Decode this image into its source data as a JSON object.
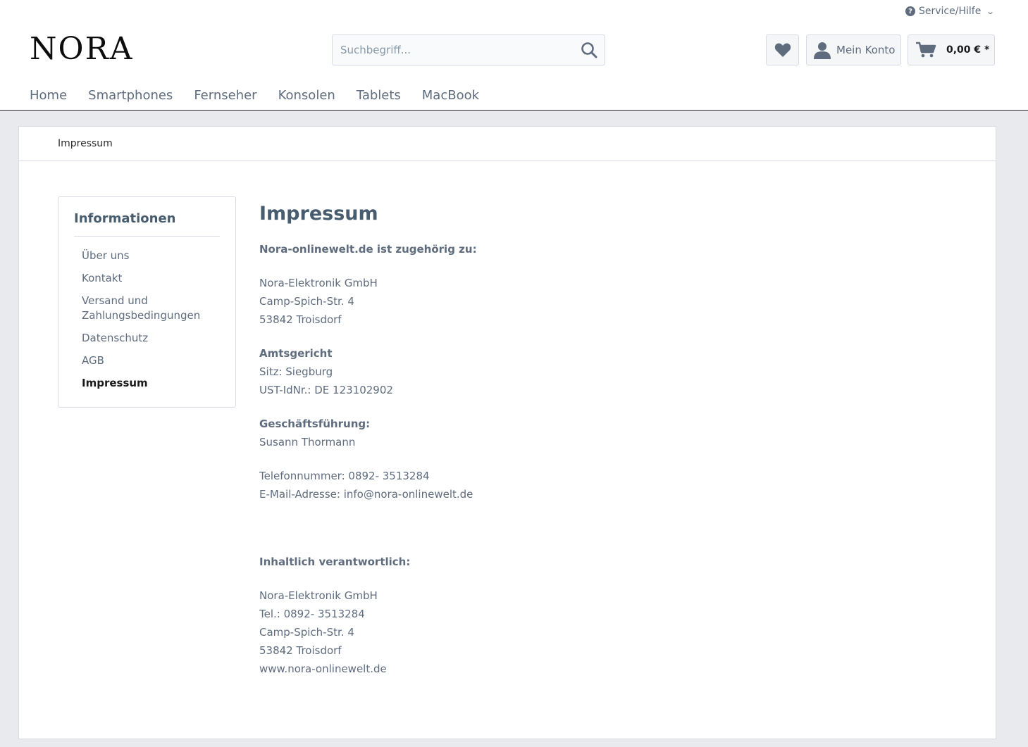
{
  "header": {
    "service_label": "Service/Hilfe",
    "logo": "NORA",
    "search_placeholder": "Suchbegriff...",
    "account_label": "Mein Konto",
    "cart_total": "0,00 € *"
  },
  "nav": {
    "items": [
      "Home",
      "Smartphones",
      "Fernseher",
      "Konsolen",
      "Tablets",
      "MacBook"
    ]
  },
  "breadcrumb": "Impressum",
  "sidebar": {
    "title": "Informationen",
    "items": [
      "Über uns",
      "Kontakt",
      "Versand und Zahlungsbedingungen",
      "Datenschutz",
      "AGB",
      "Impressum"
    ],
    "active_item": "Impressum"
  },
  "page": {
    "title": "Impressum",
    "intro": "Nora-onlinewelt.de ist zugehörig zu:",
    "company": [
      "Nora-Elektronik GmbH",
      "Camp-Spich-Str. 4",
      "53842 Troisdorf"
    ],
    "court_heading": "Amtsgericht",
    "court_lines": [
      "Sitz: Siegburg",
      "UST-IdNr.: DE 123102902"
    ],
    "management_heading": "Geschäftsführung:",
    "management_name": "Susann Thormann",
    "phone": "Telefonnummer: 0892- 3513284",
    "email": "E-Mail-Adresse: info@nora-onlinewelt.de",
    "responsible_heading": "Inhaltlich verantwortlich:",
    "responsible_lines": [
      "Nora-Elektronik GmbH",
      "Tel.: 0892- 3513284",
      "Camp-Spich-Str. 4",
      "53842 Troisdorf",
      "www.nora-onlinewelt.de"
    ]
  },
  "colors": {
    "text": "#5f6c7e",
    "heading": "#475c6e",
    "background": "#e9eaee",
    "border": "#dadae5"
  }
}
